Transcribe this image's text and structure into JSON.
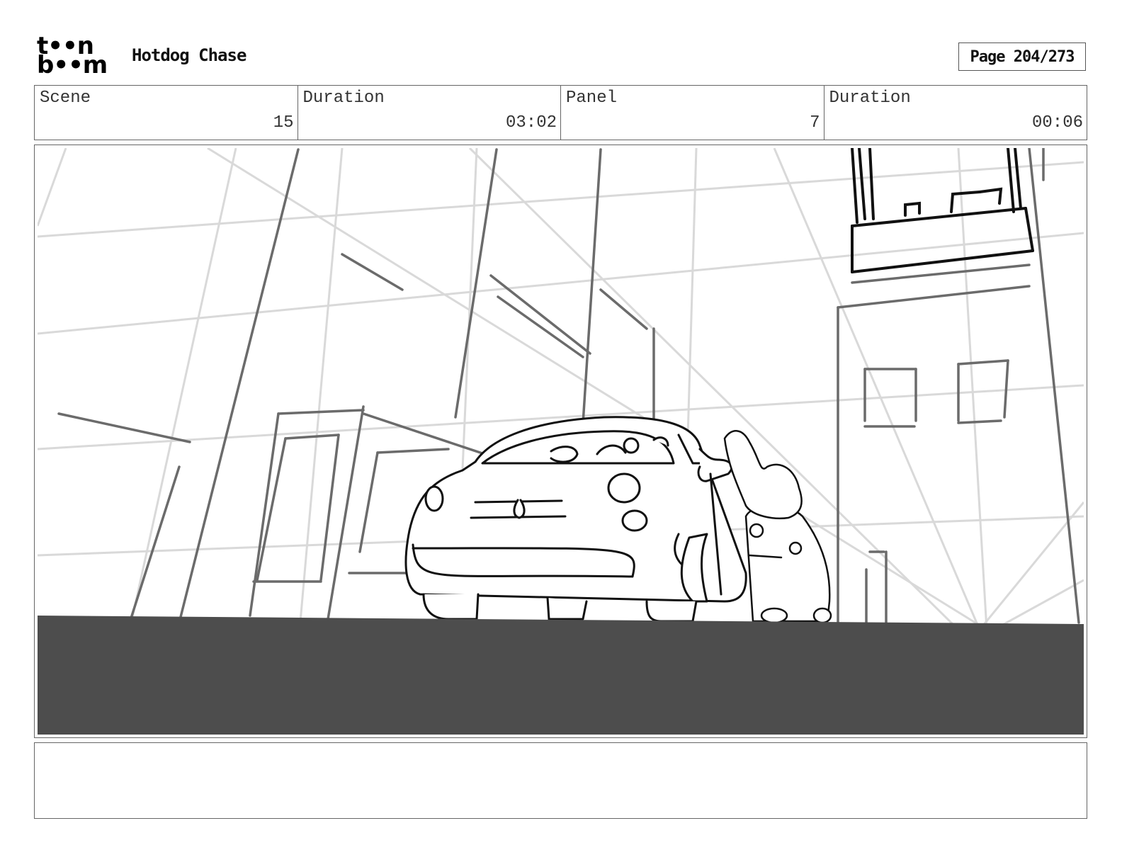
{
  "header": {
    "logo_line1": "t••n",
    "logo_line2": "b••m",
    "project_title": "Hotdog Chase",
    "page_label": "Page 204/273"
  },
  "info": [
    {
      "label": "Scene",
      "value": "15"
    },
    {
      "label": "Duration",
      "value": "03:02"
    },
    {
      "label": "Panel",
      "value": "7"
    },
    {
      "label": "Duration",
      "value": "00:06"
    }
  ],
  "notes": {
    "text": ""
  },
  "colors": {
    "ground": "#4d4d4d",
    "guide_lines": "#d9d9d9",
    "sketch_lines": "#6b6b6b",
    "ink_lines": "#111111"
  }
}
